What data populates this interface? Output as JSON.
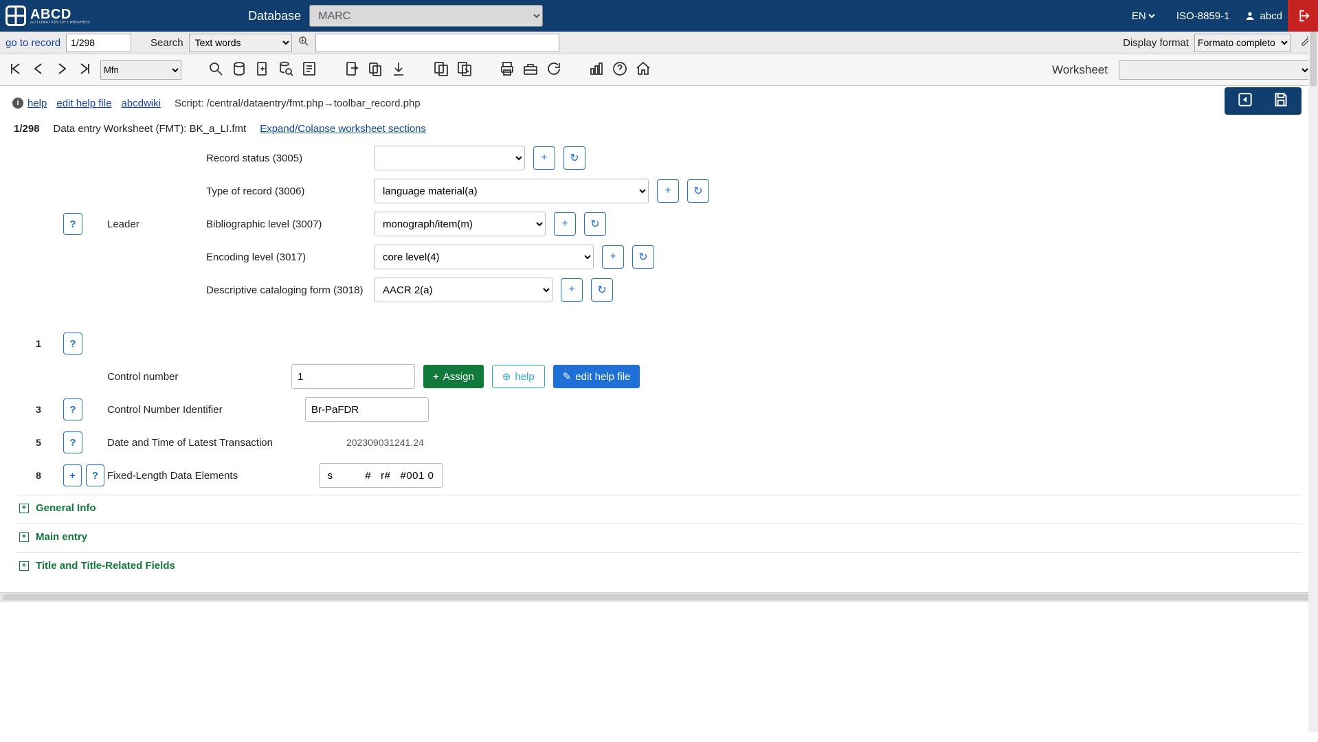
{
  "brand": {
    "name": "ABCD",
    "tagline": "AUTOMATION OF LIBRARIES"
  },
  "topbar": {
    "database_label": "Database",
    "database_value": "MARC",
    "language": "EN",
    "encoding": "ISO-8859-1",
    "username": "abcd"
  },
  "searchbar": {
    "goto_label": "go to record",
    "goto_value": "1/298",
    "search_label": "Search",
    "search_type": "Text words",
    "search_value": "",
    "display_format_label": "Display format",
    "display_format_value": "Formato completo"
  },
  "toolbar": {
    "mfn_value": "Mfn",
    "worksheet_label": "Worksheet",
    "worksheet_value": ""
  },
  "helpstrip": {
    "help_label": "help",
    "edit_help_label": "edit help file",
    "wiki_label": "abcdwiki",
    "script_path": "Script: /central/dataentry/fmt.php→toolbar_record.php"
  },
  "record_header": {
    "position": "1/298",
    "worksheet_desc": "Data entry Worksheet (FMT): BK_a_LI.fmt",
    "expand_link": "Expand/Colapse worksheet sections"
  },
  "leader": {
    "group_label": "Leader",
    "fields": {
      "record_status": {
        "label": "Record status (3005)",
        "value": ""
      },
      "type_of_record": {
        "label": "Type of record (3006)",
        "value": "language material(a)"
      },
      "biblio_level": {
        "label": "Bibliographic level (3007)",
        "value": "monograph/item(m)"
      },
      "encoding_level": {
        "label": "Encoding level (3017)",
        "value": "core level(4)"
      },
      "cat_form": {
        "label": "Descriptive cataloging form (3018)",
        "value": "AACR 2(a)"
      }
    }
  },
  "rows": {
    "r1": {
      "tag": "1",
      "label": "Control number",
      "value": "1",
      "assign": "Assign",
      "help": "help",
      "edit": "edit help file"
    },
    "r3": {
      "tag": "3",
      "label": "Control Number Identifier",
      "value": "Br-PaFDR"
    },
    "r5": {
      "tag": "5",
      "label": "Date and Time of Latest Transaction",
      "value": "202309031241.24"
    },
    "r8": {
      "tag": "8",
      "label": "Fixed-Length Data Elements",
      "value": "s          #   r#   #001 0"
    }
  },
  "sections": {
    "general": "General Info",
    "main_entry": "Main entry",
    "title_related": "Title and Title-Related Fields"
  },
  "tooltips": {
    "q": "?",
    "plus": "+",
    "refresh": "↻"
  }
}
